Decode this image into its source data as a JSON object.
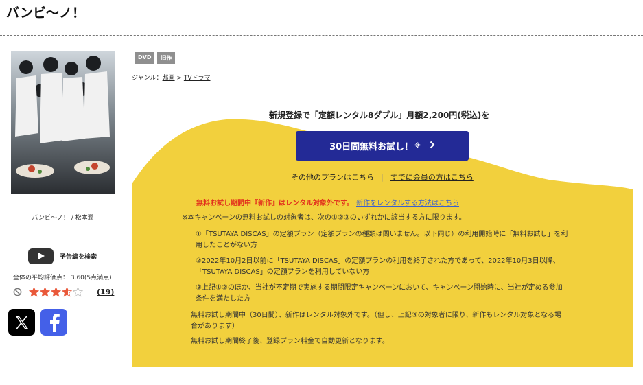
{
  "page": {
    "title": "バンビ〜ノ！"
  },
  "sidebar": {
    "cast_caption": "バンビ〜ノ！ / 松本潤",
    "trailer_label": "予告編を検索",
    "avg_rating_text": "全体の平均評価点： 3.60(5点満点)",
    "rating_value": 3.6,
    "review_count": "(19)"
  },
  "detail": {
    "badges": [
      "DVD",
      "旧作"
    ],
    "genre_label": "ジャンル：",
    "genre_1": "邦画",
    "genre_sep": " > ",
    "genre_2": "TVドラマ"
  },
  "promo": {
    "headline": "新規登録で「定額レンタル8ダブル」月額2,200円(税込)を",
    "cta_label": "30日間無料お試し！",
    "cta_note": "※",
    "other_plans": "その他のプランはこちら",
    "separator": "|",
    "member_link": "すでに会員の方はこちら",
    "warning": "無料お試し期間中『新作』はレンタル対象外です。",
    "warning_link": "新作をレンタルする方法はこちら",
    "conditions": {
      "intro": "※本キャンペーンの無料お試しの対象者は、次の①②③のいずれかに該当する方に限ります。",
      "c1_line1": "①「TSUTAYA DISCAS」の定額プラン（定額プランの種類は問いません。以下同じ）の利用開始時に「無料お試し」を利",
      "c1_line2": "用したことがない方",
      "c2_line1": "②2022年10月2日以前に「TSUTAYA DISCAS」の定額プランの利用を終了された方であって、2022年10月3日以降、",
      "c2_line2": "「TSUTAYA DISCAS」の定額プランを利用していない方",
      "c3_line1": "③上記①②のほか、当社が不定期で実施する期間限定キャンペーンにおいて、キャンペーン開始時に、当社が定める参加",
      "c3_line2": "条件を満たした方",
      "trial_line1": "無料お試し期間中（30日間）、新作はレンタル対象外です。（但し、上記③の対象者に限り、新作もレンタル対象となる場",
      "trial_line2": "合があります）",
      "renewal": "無料お試し期間終了後、登録プラン料金で自動更新となります。"
    }
  },
  "colors": {
    "promo_yellow": "#f2d03d",
    "cta_blue": "#232a96",
    "star_orange": "#e9583a",
    "warning_red": "#e2301d",
    "link_blue": "#3a5fcf"
  },
  "icons": [
    "youtube-play-icon",
    "no-entry-icon",
    "star-icon",
    "x-logo-icon",
    "facebook-logo-icon",
    "chevron-right-icon"
  ]
}
